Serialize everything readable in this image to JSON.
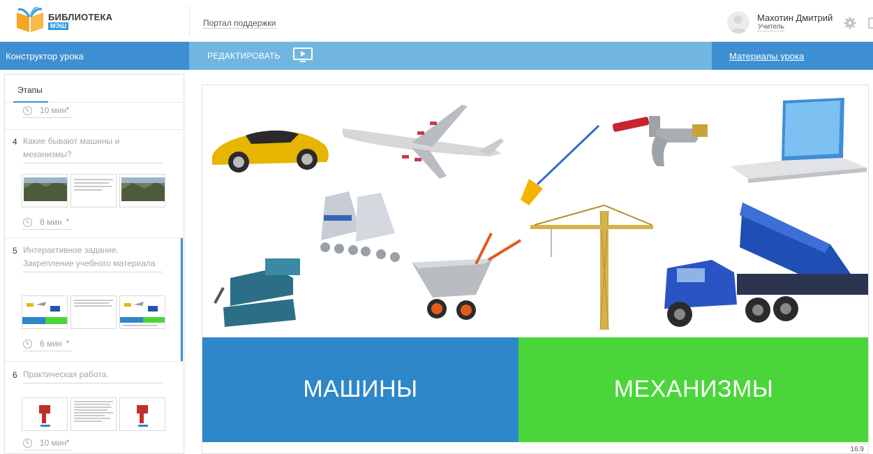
{
  "header": {
    "logo_title": "БИБЛИОТЕКА",
    "logo_subtitle": "МЭШ",
    "support_link": "Портал поддержки",
    "user_name": "Махотин Дмитрий",
    "user_role": "Учитель"
  },
  "toolbar": {
    "left_title": "Конструктор урока",
    "edit_label": "РЕДАКТИРОВАТЬ",
    "materials_label": "Материалы урока"
  },
  "stages": {
    "tab_label": "Этапы",
    "top_time": "10 мин",
    "items": [
      {
        "num": "4",
        "title": "Какие бывают машины и механизмы?",
        "time": "8 мин"
      },
      {
        "num": "5",
        "title": "Интерактивное задание. Закрепление учебного материала",
        "time": "6 мин"
      },
      {
        "num": "6",
        "title": "Практическая работа.",
        "time": "10 мин"
      }
    ]
  },
  "slide": {
    "left_card": "МАШИНЫ",
    "right_card": "МЕХАНИЗМЫ",
    "left_color": "#2e87c8",
    "right_color": "#4ad63a",
    "aspect_label": "16:9"
  },
  "icons": [
    "book-logo-icon",
    "clock-icon",
    "gear-icon",
    "exit-icon",
    "present-icon"
  ]
}
